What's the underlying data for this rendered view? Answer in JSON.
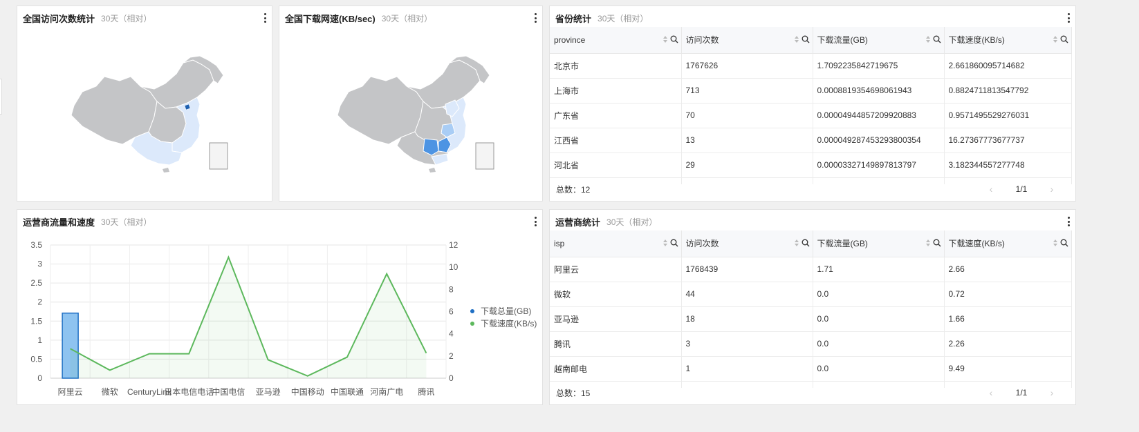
{
  "panels": {
    "visits_map": {
      "title": "全国访问次数统计",
      "subtitle": "30天（相对）"
    },
    "speed_map": {
      "title": "全国下载网速(KB/sec)",
      "subtitle": "30天（相对）"
    },
    "province_table": {
      "title": "省份统计",
      "subtitle": "30天（相对）",
      "columns": [
        "province",
        "访问次数",
        "下载流量(GB)",
        "下载速度(KB/s)"
      ],
      "rows": [
        [
          "北京市",
          "1767626",
          "1.7092235842719675",
          "2.661860095714682"
        ],
        [
          "上海市",
          "713",
          "0.0008819354698061943",
          "0.8824711813547792"
        ],
        [
          "广东省",
          "70",
          "0.0000494485720992088​3",
          "0.9571495529276031"
        ],
        [
          "江西省",
          "13",
          "0.000049287453293800354",
          "16.27367773677737"
        ],
        [
          "河北省",
          "29",
          "0.000033271498978137​97",
          "3.182344557277748"
        ]
      ],
      "total": "总数：12",
      "page": "1/1"
    },
    "isp_chart": {
      "title": "运营商流量和速度",
      "subtitle": "30天（相对）"
    },
    "isp_table": {
      "title": "运营商统计",
      "subtitle": "30天（相对）",
      "columns": [
        "isp",
        "访问次数",
        "下载流量(GB)",
        "下载速度(KB/s)"
      ],
      "rows": [
        [
          "阿里云",
          "1768439",
          "1.71",
          "2.66"
        ],
        [
          "微软",
          "44",
          "0.0",
          "0.72"
        ],
        [
          "亚马逊",
          "18",
          "0.0",
          "1.66"
        ],
        [
          "腾讯",
          "3",
          "0.0",
          "2.26"
        ],
        [
          "越南邮电",
          "1",
          "0.0",
          "9.49"
        ]
      ],
      "total": "总数：15",
      "page": "1/1"
    }
  },
  "colors": {
    "bar": "#8ec3f0",
    "bar_stroke": "#1f6fc4",
    "line": "#5cb85c",
    "map_base": "#c4c5c7",
    "map_light": "#dce9fb",
    "map_mid": "#a9cdf5",
    "map_dark": "#1c5fb0",
    "map_strong": "#4d94e3"
  },
  "chart_data": {
    "type": "bar",
    "categories": [
      "阿里云",
      "微软",
      "CenturyLink",
      "日本电信电话",
      "中国电信",
      "亚马逊",
      "中国移动",
      "中国联通",
      "河南广电",
      "腾讯"
    ],
    "category_labels": [
      "阿里云",
      "微软",
      "CenturyLink",
      "日本电信电话",
      "中国电信",
      "亚马逊",
      "中国移动",
      "中国联通",
      "河南广电",
      "腾讯"
    ],
    "series": [
      {
        "name": "下载总量(GB)",
        "type": "bar",
        "axis": "left",
        "values": [
          1.71,
          0,
          0,
          0,
          0,
          0,
          0,
          0,
          0,
          0
        ]
      },
      {
        "name": "下载速度(KB/s)",
        "type": "area",
        "axis": "right",
        "values": [
          2.66,
          0.72,
          2.2,
          2.2,
          10.9,
          1.66,
          0.2,
          1.9,
          9.4,
          2.26
        ]
      }
    ],
    "left_axis": {
      "ticks": [
        "3.5",
        "3",
        "2.5",
        "2",
        "1.5",
        "1",
        "0.5",
        "0"
      ],
      "range": [
        0,
        3.5
      ]
    },
    "right_axis": {
      "ticks": [
        "12",
        "10",
        "8",
        "6",
        "4",
        "2",
        "0"
      ],
      "range": [
        0,
        12
      ]
    },
    "legend": [
      "下载总量(GB)",
      "下载速度(KB/s)"
    ],
    "legend_position": "right",
    "grid": true
  }
}
